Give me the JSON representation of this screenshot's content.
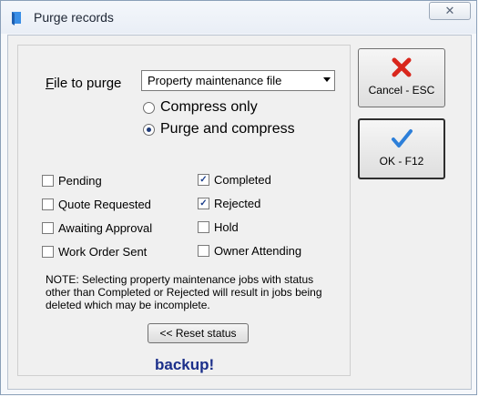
{
  "window": {
    "title": "Purge records",
    "close_glyph": "✕"
  },
  "file_to_purge": {
    "label_underlined": "F",
    "label_rest": "ile to purge",
    "selected": "Property maintenance file"
  },
  "mode": {
    "options": [
      {
        "label": "Compress only",
        "selected": false
      },
      {
        "label": "Purge and compress",
        "selected": true
      }
    ]
  },
  "status": {
    "left": [
      {
        "label": "Pending",
        "checked": false
      },
      {
        "label": "Quote Requested",
        "checked": false
      },
      {
        "label": "Awaiting Approval",
        "checked": false
      },
      {
        "label": "Work Order Sent",
        "checked": false
      }
    ],
    "right": [
      {
        "label": "Completed",
        "checked": true
      },
      {
        "label": "Rejected",
        "checked": true
      },
      {
        "label": "Hold",
        "checked": false
      },
      {
        "label": "Owner Attending",
        "checked": false
      }
    ]
  },
  "note": "NOTE: Selecting property maintenance jobs with status other than Completed or Rejected will result in jobs being deleted which may be incomplete.",
  "reset_button": "<< Reset status",
  "backup_text": "backup!",
  "buttons": {
    "cancel": {
      "label": "Cancel - ESC",
      "icon": "red-x-icon"
    },
    "ok": {
      "label": "OK - F12",
      "icon": "blue-check-icon"
    }
  },
  "colors": {
    "accent_text": "#1b2f8a",
    "cancel_icon": "#d9261c",
    "ok_icon": "#2d7fd9"
  }
}
